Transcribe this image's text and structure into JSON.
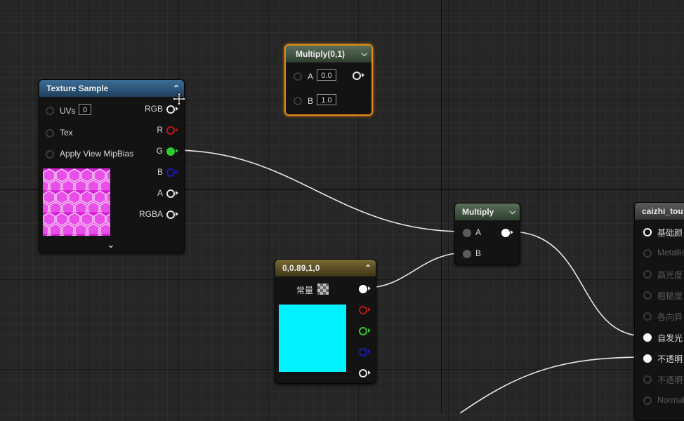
{
  "nodes": {
    "texture_sample": {
      "title": "Texture Sample",
      "uvs_label": "UVs",
      "uvs_value": "0",
      "tex_label": "Tex",
      "mipbias_label": "Apply View MipBias",
      "outputs": [
        "RGB",
        "R",
        "G",
        "B",
        "A",
        "RGBA"
      ],
      "collapse_glyph": "^",
      "expand_glyph": "⌄"
    },
    "multiply_01": {
      "title": "Multiply(0,1)",
      "a_label": "A",
      "a_value": "0.0",
      "b_label": "B",
      "b_value": "1.0"
    },
    "multiply": {
      "title": "Multiply",
      "a_label": "A",
      "b_label": "B"
    },
    "constant": {
      "title": "0,0.89,1,0",
      "label": "常量",
      "preview_color": "#00f2ff"
    },
    "material": {
      "title": "caizhi_tou",
      "inputs": [
        {
          "label": "基础颜",
          "active": true
        },
        {
          "label": "Metallic",
          "active": false
        },
        {
          "label": "高光度",
          "active": false
        },
        {
          "label": "粗糙度",
          "active": false
        },
        {
          "label": "各向异",
          "active": false
        },
        {
          "label": "自发光",
          "active": true
        },
        {
          "label": "不透明",
          "active": true
        },
        {
          "label": "不透明",
          "active": false
        },
        {
          "label": "Normal",
          "active": false
        }
      ]
    }
  },
  "colors": {
    "selection": "#e08a14",
    "pin_green": "#2ecc2e",
    "pin_red": "#b51a1a",
    "pin_blue": "#1a1ab5",
    "texture_magenta": "#d61ed6"
  }
}
